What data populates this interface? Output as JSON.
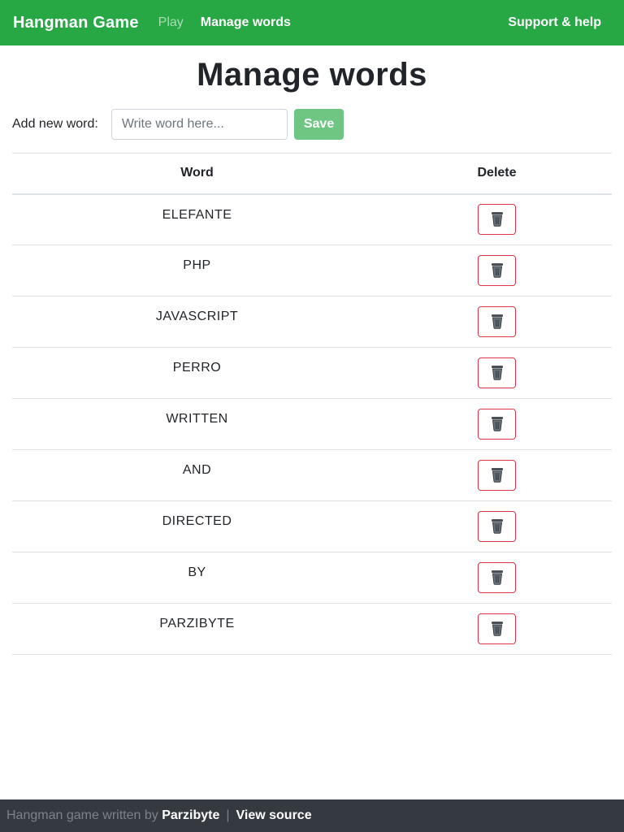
{
  "navbar": {
    "brand": "Hangman Game",
    "links": [
      {
        "label": "Play"
      },
      {
        "label": "Manage words"
      }
    ],
    "right_link": "Support & help"
  },
  "page": {
    "title": "Manage words"
  },
  "add_form": {
    "label": "Add new word:",
    "input_value": "",
    "input_placeholder": "Write word here...",
    "save_label": "Save"
  },
  "table": {
    "headers": [
      "Word",
      "Delete"
    ],
    "rows": [
      {
        "word": "ELEFANTE"
      },
      {
        "word": "PHP"
      },
      {
        "word": "JAVASCRIPT"
      },
      {
        "word": "PERRO"
      },
      {
        "word": "WRITTEN"
      },
      {
        "word": "AND"
      },
      {
        "word": "DIRECTED"
      },
      {
        "word": "BY"
      },
      {
        "word": "PARZIBYTE"
      }
    ],
    "delete_icon": "trash-icon"
  },
  "footer": {
    "text": "Hangman game written by",
    "author": "Parzibyte",
    "separator": "|",
    "source_link": "View source"
  },
  "colors": {
    "navbar": "#28a745",
    "footer": "#343a40",
    "save_button": "#6fc683",
    "delete_border": "#dc3545"
  }
}
